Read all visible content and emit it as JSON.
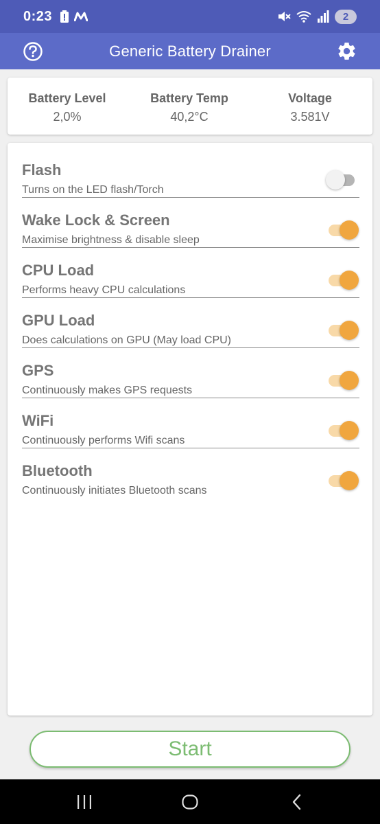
{
  "status_bar": {
    "time": "0:23",
    "notification_count": "2",
    "icons": [
      "battery-alert-icon",
      "m-logo-icon",
      "mute-icon",
      "wifi-icon",
      "signal-icon"
    ]
  },
  "app_bar": {
    "title": "Generic Battery Drainer",
    "icons": [
      "help-icon",
      "settings-icon"
    ]
  },
  "stats": [
    {
      "label": "Battery Level",
      "value": "2,0%"
    },
    {
      "label": "Battery Temp",
      "value": "40,2°C"
    },
    {
      "label": "Voltage",
      "value": "3.581V"
    }
  ],
  "toggles": [
    {
      "title": "Flash",
      "subtitle": "Turns on the LED flash/Torch",
      "enabled": false
    },
    {
      "title": "Wake Lock & Screen",
      "subtitle": "Maximise brightness & disable sleep",
      "enabled": true
    },
    {
      "title": "CPU Load",
      "subtitle": "Performs heavy CPU calculations",
      "enabled": true
    },
    {
      "title": "GPU Load",
      "subtitle": "Does calculations on GPU (May load CPU)",
      "enabled": true
    },
    {
      "title": "GPS",
      "subtitle": "Continuously makes GPS requests",
      "enabled": true
    },
    {
      "title": "WiFi",
      "subtitle": "Continuously performs Wifi scans",
      "enabled": true
    },
    {
      "title": "Bluetooth",
      "subtitle": "Continuously initiates Bluetooth scans",
      "enabled": true
    }
  ],
  "start_button": {
    "label": "Start"
  },
  "colors": {
    "app_bar": "#5c6bc8",
    "status_bar": "#4e5bb7",
    "switch_on": "#f0a63f",
    "start": "#7cbc72"
  }
}
